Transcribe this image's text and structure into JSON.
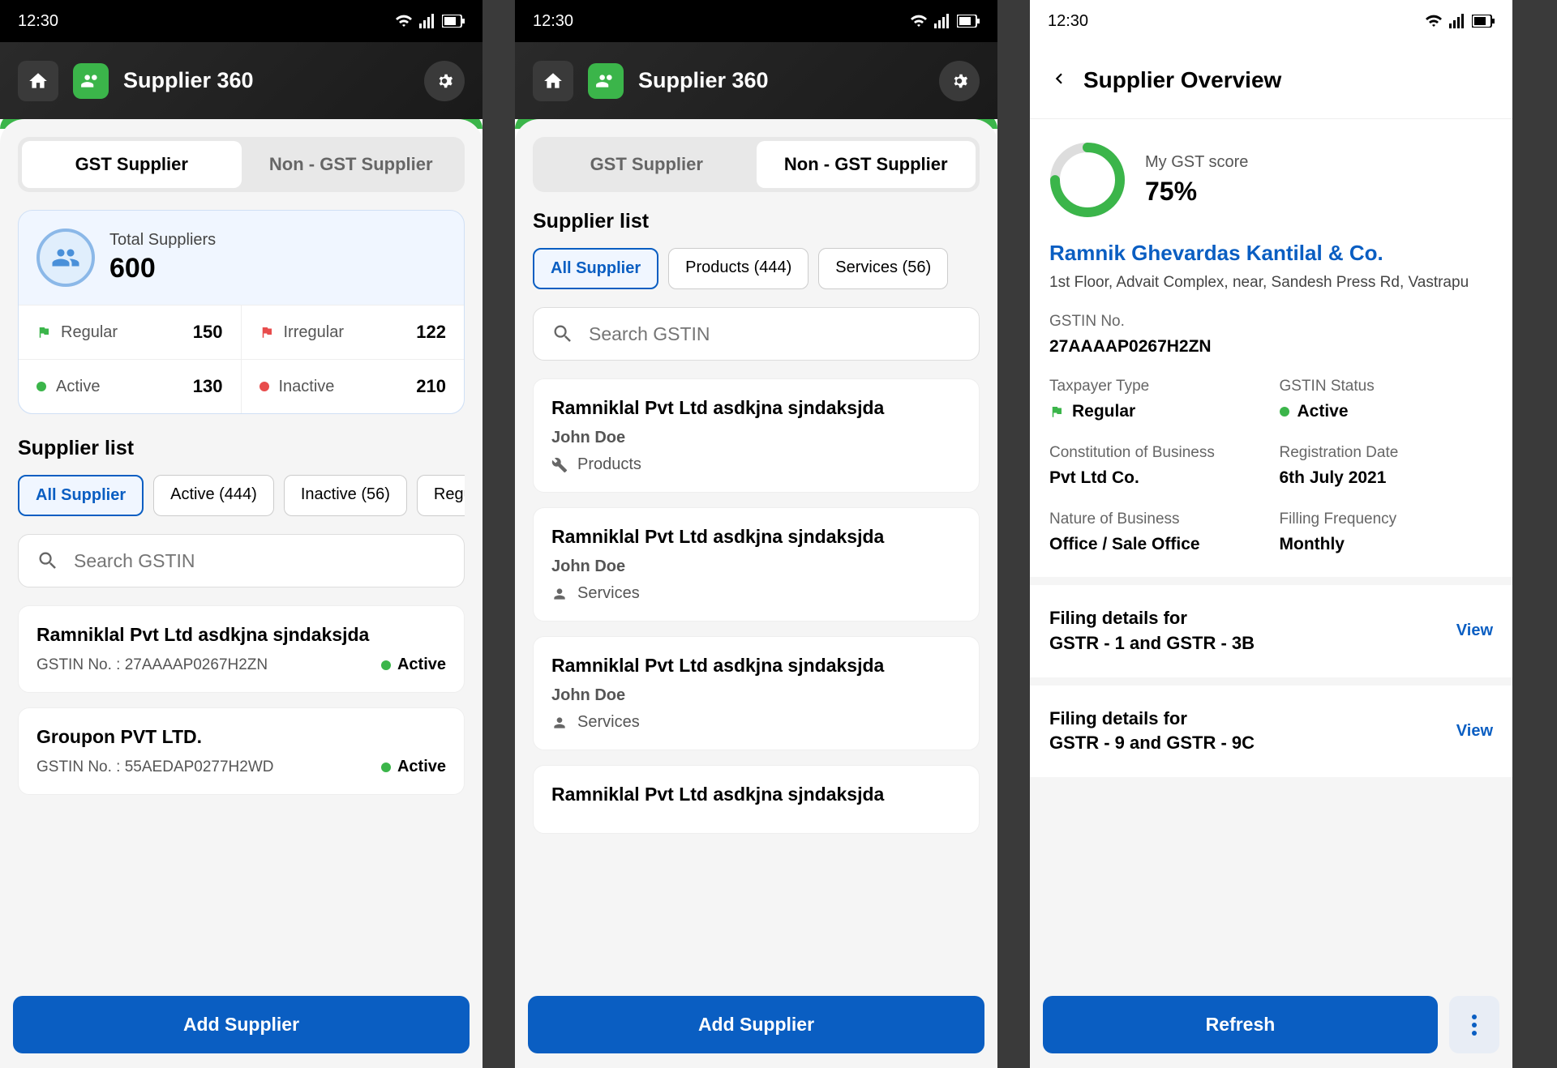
{
  "status": {
    "time": "12:30"
  },
  "app_title": "Supplier 360",
  "screen1": {
    "tabs": {
      "gst": "GST Supplier",
      "nongst": "Non - GST Supplier"
    },
    "stats": {
      "total_label": "Total Suppliers",
      "total_value": "600",
      "regular_label": "Regular",
      "regular_value": "150",
      "irregular_label": "Irregular",
      "irregular_value": "122",
      "active_label": "Active",
      "active_value": "130",
      "inactive_label": "Inactive",
      "inactive_value": "210"
    },
    "list_heading": "Supplier list",
    "chips": {
      "all": "All Supplier",
      "active": "Active (444)",
      "inactive": "Inactive (56)",
      "regular": "Regular"
    },
    "search_placeholder": "Search GSTIN",
    "card1": {
      "name": "Ramniklal Pvt Ltd asdkjna sjndaksjda",
      "gstin": "GSTIN No. : 27AAAAP0267H2ZN",
      "status": "Active"
    },
    "card2": {
      "name": "Groupon PVT LTD.",
      "gstin": "GSTIN No. : 55AEDAP0277H2WD",
      "status": "Active"
    },
    "add_btn": "Add Supplier"
  },
  "screen2": {
    "tabs": {
      "gst": "GST Supplier",
      "nongst": "Non - GST Supplier"
    },
    "list_heading": "Supplier list",
    "chips": {
      "all": "All Supplier",
      "products": "Products (444)",
      "services": "Services (56)"
    },
    "search_placeholder": "Search GSTIN",
    "cards": [
      {
        "name": "Ramniklal Pvt Ltd asdkjna sjndaksjda",
        "contact": "John Doe",
        "type": "Products"
      },
      {
        "name": "Ramniklal Pvt Ltd asdkjna sjndaksjda",
        "contact": "John Doe",
        "type": "Services"
      },
      {
        "name": "Ramniklal Pvt Ltd asdkjna sjndaksjda",
        "contact": "John Doe",
        "type": "Services"
      },
      {
        "name": "Ramniklal Pvt Ltd asdkjna sjndaksjda",
        "contact": "",
        "type": ""
      }
    ],
    "add_btn": "Add Supplier"
  },
  "screen3": {
    "title": "Supplier Overview",
    "score_label": "My GST score",
    "score_value": "75%",
    "company": "Ramnik Ghevardas Kantilal & Co.",
    "address": "1st Floor, Advait Complex, near, Sandesh Press Rd, Vastrapu",
    "gstin_label": "GSTIN No.",
    "gstin_value": "27AAAAP0267H2ZN",
    "taxpayer_label": "Taxpayer Type",
    "taxpayer_value": "Regular",
    "status_label": "GSTIN Status",
    "status_value": "Active",
    "constitution_label": "Constitution of Business",
    "constitution_value": "Pvt Ltd Co.",
    "regdate_label": "Registration Date",
    "regdate_value": "6th July 2021",
    "nature_label": "Nature of Business",
    "nature_value": "Office / Sale Office",
    "freq_label": "Filling Frequency",
    "freq_value": "Monthly",
    "filing1_line1": "Filing details for",
    "filing1_line2": "GSTR - 1 and GSTR - 3B",
    "filing2_line1": "Filing details for",
    "filing2_line2": "GSTR - 9 and GSTR - 9C",
    "view": "View",
    "refresh": "Refresh"
  }
}
